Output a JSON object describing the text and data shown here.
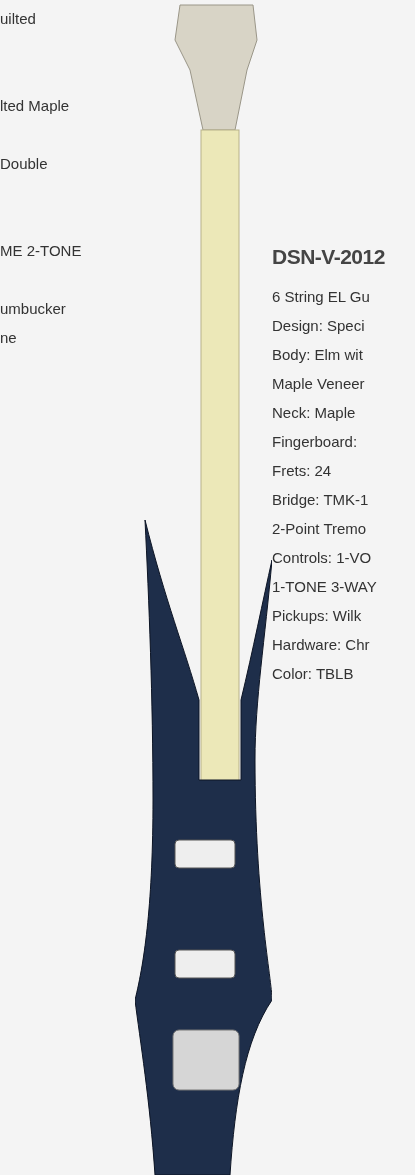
{
  "left_specs": [
    [
      "uilted"
    ],
    [
      "lted Maple"
    ],
    [
      "Double"
    ],
    [
      "ME 2-TONE"
    ],
    [
      "umbucker",
      "ne"
    ]
  ],
  "product": {
    "title": "DSN-V-2012",
    "specs": [
      "6 String EL Gu",
      "Design: Speci",
      "Body: Elm wit",
      "Maple Veneer",
      "Neck: Maple",
      "Fingerboard:",
      "Frets: 24",
      "Bridge: TMK-1",
      "2-Point Tremo",
      "Controls: 1-VO",
      "1-TONE 3-WAY",
      "Pickups: Wilk",
      "Hardware: Chr",
      "Color: TBLB"
    ]
  }
}
